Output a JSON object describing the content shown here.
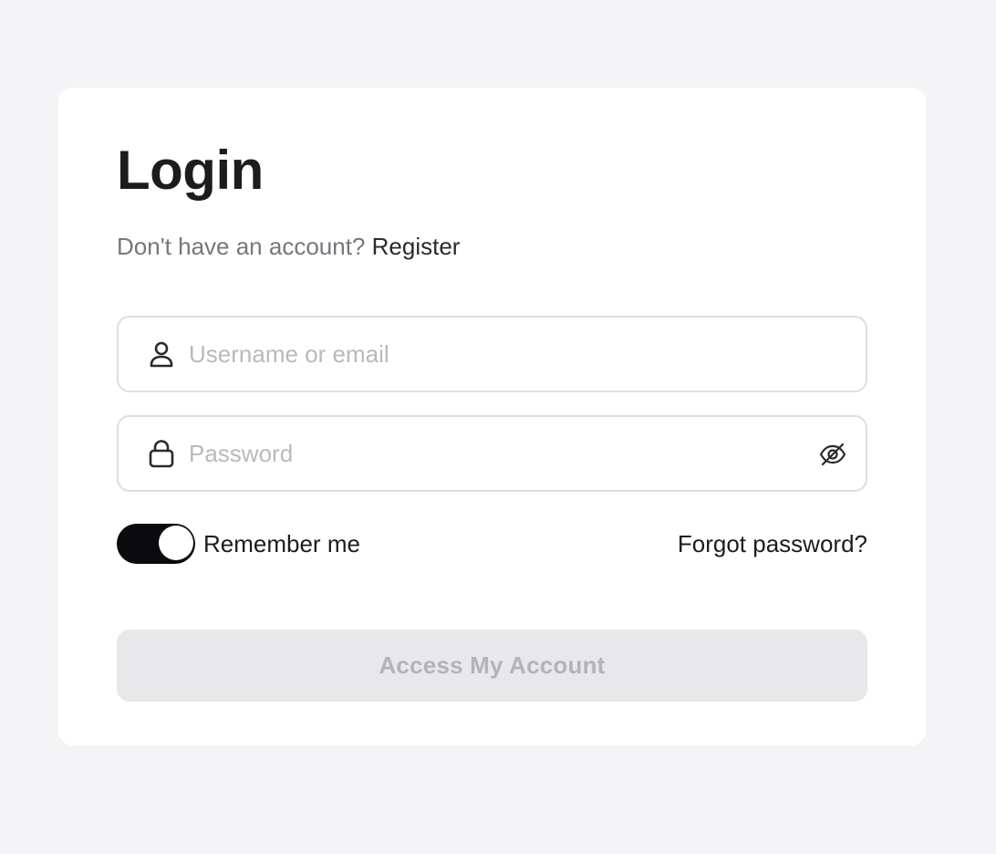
{
  "login": {
    "title": "Login",
    "subtitle_prefix": "Don't have an account?",
    "register_link": "Register",
    "username": {
      "value": "",
      "placeholder": "Username or email",
      "icon": "user-icon"
    },
    "password": {
      "value": "",
      "placeholder": "Password",
      "icon": "lock-icon",
      "toggle_icon": "eye-off-icon"
    },
    "remember": {
      "label": "Remember me",
      "checked": true
    },
    "forgot_link": "Forgot password?",
    "submit": {
      "label": "Access My Account",
      "enabled": false
    }
  },
  "colors": {
    "background": "#f4f4f6",
    "card": "#ffffff",
    "text_primary": "#1c1c1e",
    "text_muted": "#76767c",
    "toggle_on": "#0b0b0d",
    "button_disabled_bg": "#e8e8ea",
    "button_disabled_text": "#b3b3b8"
  }
}
